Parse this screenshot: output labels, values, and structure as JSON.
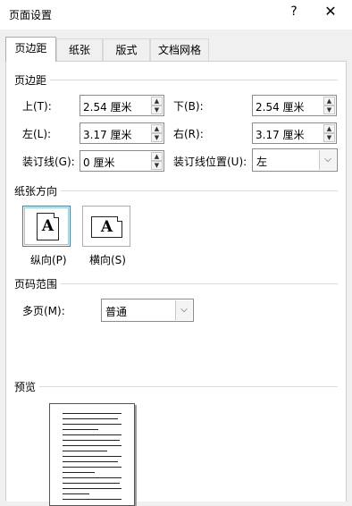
{
  "window": {
    "title": "页面设置",
    "help_glyph": "?",
    "close_glyph": "✕"
  },
  "tabs": [
    {
      "label": "页边距",
      "active": true
    },
    {
      "label": "纸张",
      "active": false
    },
    {
      "label": "版式",
      "active": false
    },
    {
      "label": "文档网格",
      "active": false
    }
  ],
  "margins": {
    "heading": "页边距",
    "top": {
      "label": "上(T):",
      "value": "2.54 厘米"
    },
    "bottom": {
      "label": "下(B):",
      "value": "2.54 厘米"
    },
    "left": {
      "label": "左(L):",
      "value": "3.17 厘米"
    },
    "right": {
      "label": "右(R):",
      "value": "3.17 厘米"
    },
    "gutter": {
      "label": "装订线(G):",
      "value": "0 厘米"
    },
    "gutter_position": {
      "label": "装订线位置(U):",
      "value": "左"
    }
  },
  "orientation": {
    "heading": "纸张方向",
    "portrait": {
      "label": "纵向(P)",
      "glyph": "A",
      "selected": true
    },
    "landscape": {
      "label": "横向(S)",
      "glyph": "A",
      "selected": false
    }
  },
  "pages": {
    "heading": "页码范围",
    "multiple": {
      "label": "多页(M):",
      "value": "普通"
    }
  },
  "preview": {
    "heading": "预览"
  },
  "icons": {
    "spin_up": "▲",
    "spin_down": "▼",
    "dropdown": "⌵"
  }
}
